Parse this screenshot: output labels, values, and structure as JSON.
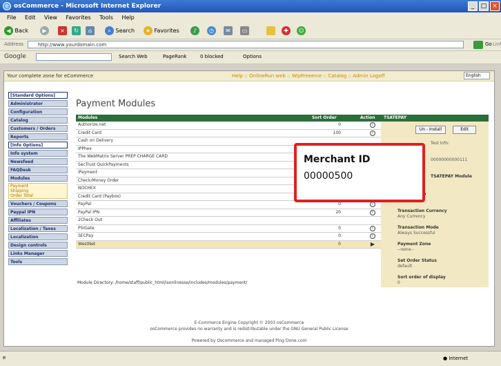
{
  "window": {
    "title": "osCommerce - Microsoft Internet Explorer",
    "min": "_",
    "max": "□",
    "close": "×"
  },
  "menu": [
    "File",
    "Edit",
    "View",
    "Favorites",
    "Tools",
    "Help"
  ],
  "toolbar": {
    "back": "Back",
    "search": "Search",
    "favorites": "Favorites"
  },
  "address": {
    "label": "Address",
    "value": "http://www.yourdomain.com",
    "go": "Go",
    "links": "Links"
  },
  "google": {
    "label": "Google",
    "search": "Search Web",
    "pagerank": "PageRank",
    "blocked": "0 blocked",
    "options": "Options"
  },
  "page": {
    "zone_text": "Your complete zone for eCommerce",
    "top_links": "Help :: OnlineRun web :: WipFreeerce :: Catalog :: Admin Logoff",
    "language": "English"
  },
  "leftnav": [
    {
      "label": "[Standard Options]",
      "hdr": true
    },
    {
      "label": "Administrator"
    },
    {
      "label": "Configuration"
    },
    {
      "label": "Catalog"
    },
    {
      "label": "Customers / Orders"
    },
    {
      "label": "Reports"
    },
    {
      "label": "[Info Options]",
      "hdr": true
    },
    {
      "label": "Info system"
    },
    {
      "label": "Newsfeed"
    },
    {
      "label": "FAQDesk"
    },
    {
      "label": "Modules"
    }
  ],
  "leftnav_sub": [
    "Payment",
    "Shipping",
    "Order Total"
  ],
  "leftnav2": [
    {
      "label": "Vouchers / Coupons"
    },
    {
      "label": "Paypal IPN"
    },
    {
      "label": "Affiliates"
    },
    {
      "label": "Localization / Taxes"
    },
    {
      "label": "Localization"
    },
    {
      "label": "Design controls"
    },
    {
      "label": "Links Manager"
    },
    {
      "label": "Tools"
    }
  ],
  "page_title": "Payment Modules",
  "table": {
    "headers": {
      "modules": "Modules",
      "sort": "Sort Order",
      "action": "Action"
    },
    "rows": [
      {
        "name": "Authorize.net",
        "sort": "0",
        "action": "i"
      },
      {
        "name": "Credit Card",
        "sort": "100",
        "action": "i"
      },
      {
        "name": "Cash on Delivery",
        "sort": "",
        "action": ""
      },
      {
        "name": "IPPhex",
        "sort": "",
        "action": ""
      },
      {
        "name": "The WebMatrix Server PREP CHARGE CARD",
        "sort": "",
        "action": ""
      },
      {
        "name": "SecTrust QuickPayments",
        "sort": "",
        "action": ""
      },
      {
        "name": "iPayment",
        "sort": "",
        "action": ""
      },
      {
        "name": "Check/Money Order",
        "sort": "0",
        "action": "i"
      },
      {
        "name": "NOCHEX",
        "sort": "0",
        "action": "i"
      },
      {
        "name": "Credit Card (Paybox)",
        "sort": "0",
        "action": "i"
      },
      {
        "name": "PayPal",
        "sort": "0",
        "action": "i"
      },
      {
        "name": "PayPal IPN",
        "sort": "20",
        "action": "i"
      },
      {
        "name": "2Check Out",
        "sort": "",
        "action": ""
      },
      {
        "name": "PSIGate",
        "sort": "0",
        "action": "i"
      },
      {
        "name": "SECPay",
        "sort": "0",
        "action": "i"
      },
      {
        "name": "WestNet",
        "sort": "0",
        "action": "▶",
        "selected": true
      }
    ],
    "module_dir": "Module Directory: /home/staff/public_html/isonlinesse/includes/modules/payment/"
  },
  "right_panel": {
    "header": "TSATEPAY",
    "buttons": [
      "Un - Install",
      "Edit"
    ],
    "test_info": "Test Info:",
    "test_value": "00000000000111",
    "enable": "TSATEPAY Module",
    "fields": [
      {
        "label": "Merchant ID",
        "value": "00000500"
      },
      {
        "label": "Transaction Currency",
        "value": "Any Currency"
      },
      {
        "label": "Transaction Mode",
        "value": "Always Successful"
      },
      {
        "label": "Payment Zone",
        "value": "--none--"
      },
      {
        "label": "Set Order Status",
        "value": "default"
      },
      {
        "label": "Sort order of display",
        "value": "0"
      }
    ]
  },
  "callout": {
    "title": "Merchant ID",
    "value": "00000500"
  },
  "footer": [
    "E-Commerce Engine Copyright © 2003 osCommerce",
    "osCommerce provides no warranty and is redistributable under the GNU General Public License",
    "Powered by Oscommerce and managed Ping Done.com"
  ],
  "status": {
    "zone": "Internet"
  },
  "colors": {
    "header_green": "#2b6e3a",
    "panel": "#f2e9c4",
    "callout_border": "#e02020",
    "titlebar": "#2455b8"
  }
}
